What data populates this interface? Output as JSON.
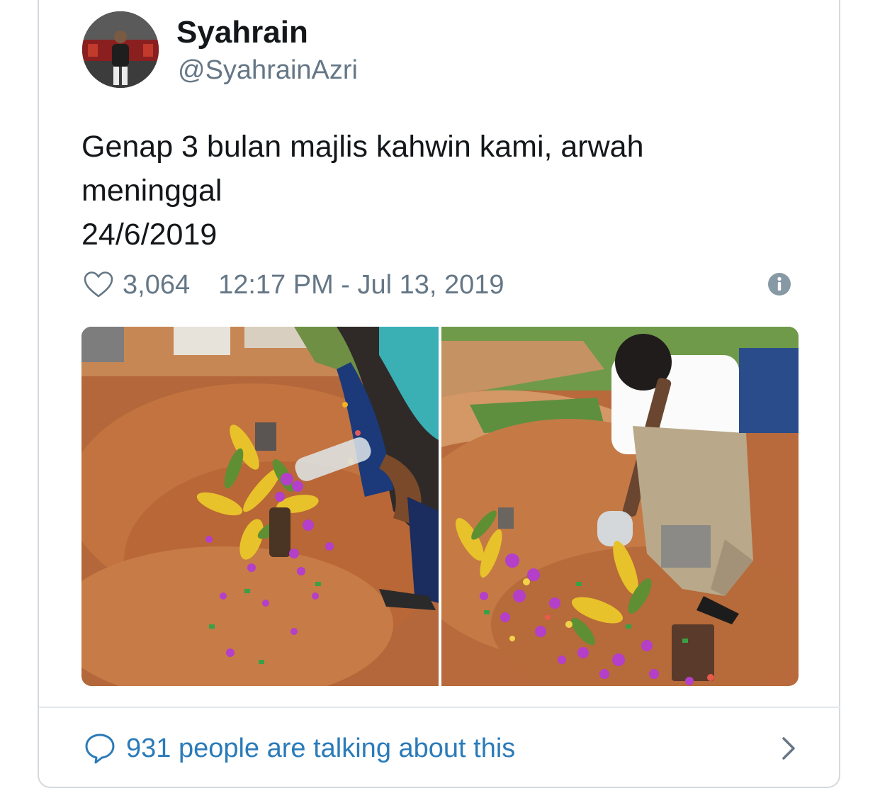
{
  "tweet": {
    "display_name": "Syahrain",
    "handle": "@SyahrainAzri",
    "text": "Genap 3 bulan majlis kahwin kami, arwah\nmeninggal\n24/6/2019",
    "like_count": "3,064",
    "timestamp": "12:17 PM - Jul 13, 2019"
  },
  "footer": {
    "talking_label": "931 people are talking about this"
  },
  "icons": {
    "like": "heart-outline-icon",
    "info": "info-circle-icon",
    "reply": "speech-bubble-icon",
    "more": "chevron-right-icon"
  },
  "colors": {
    "text": "#14171a",
    "secondary": "#657786",
    "link": "#2b7bb9",
    "border": "#d4d9de"
  }
}
